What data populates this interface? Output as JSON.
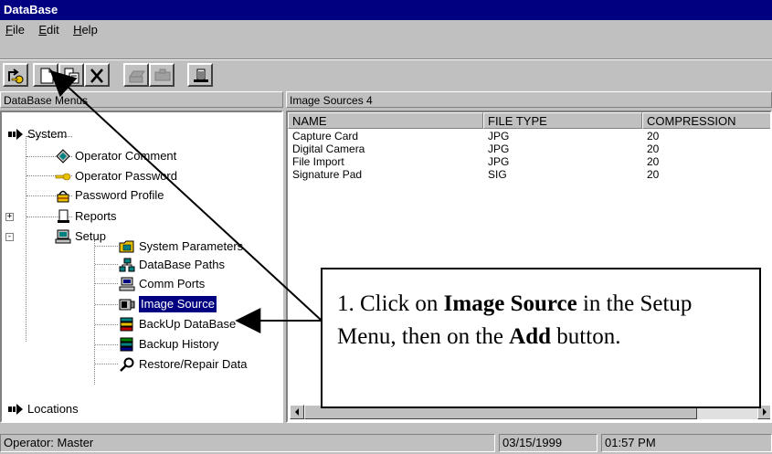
{
  "window": {
    "title": "DataBase"
  },
  "menu": {
    "file": "File",
    "file_key": "F",
    "file_rest": "ile",
    "edit": "Edit",
    "edit_key": "E",
    "edit_rest": "dit",
    "help": "Help",
    "help_key": "H",
    "help_rest": "elp"
  },
  "toolbar": {
    "buttons": [
      {
        "name": "exit-button",
        "icon": "key-exit-icon"
      },
      {
        "name": "add-button",
        "icon": "new-document-icon"
      },
      {
        "name": "copy-button",
        "icon": "copy-icon"
      },
      {
        "name": "delete-button",
        "icon": "delete-x-icon"
      },
      {
        "name": "print-button",
        "icon": "printer-icon"
      },
      {
        "name": "scan-button",
        "icon": "scanner-icon"
      },
      {
        "name": "report-button",
        "icon": "report-icon"
      }
    ]
  },
  "tree": {
    "header": "DataBase Menus",
    "items": [
      {
        "label": "System",
        "icon": "arrow-right-icon"
      },
      {
        "label": "Operator Comment",
        "icon": "comment-icon"
      },
      {
        "label": "Operator Password",
        "icon": "key-icon"
      },
      {
        "label": "Password Profile",
        "icon": "lock-profile-icon"
      },
      {
        "label": "Reports",
        "icon": "reports-icon"
      },
      {
        "label": "Setup",
        "icon": "computer-icon"
      },
      {
        "label": "System Parameters",
        "icon": "folder-settings-icon"
      },
      {
        "label": "DataBase Paths",
        "icon": "network-icon"
      },
      {
        "label": "Comm Ports",
        "icon": "port-icon"
      },
      {
        "label": "Image Source",
        "icon": "camera-icon"
      },
      {
        "label": "BackUp DataBase",
        "icon": "backup-icon"
      },
      {
        "label": "Backup History",
        "icon": "history-icon"
      },
      {
        "label": "Restore/Repair Data",
        "icon": "repair-icon"
      },
      {
        "label": "Locations",
        "icon": "arrow-right-icon"
      }
    ],
    "selected": "Image Source"
  },
  "list": {
    "header": "Image Sources  4",
    "columns": [
      "NAME",
      "FILE TYPE",
      "COMPRESSION"
    ],
    "rows": [
      [
        "Capture Card",
        "JPG",
        "20"
      ],
      [
        "Digital Camera",
        "JPG",
        "20"
      ],
      [
        "File Import",
        "JPG",
        "20"
      ],
      [
        "Signature Pad",
        "SIG",
        "20"
      ]
    ]
  },
  "status": {
    "operator": "Operator: Master",
    "date": "03/15/1999",
    "time": "01:57 PM"
  },
  "callout": {
    "p1": "1. Click on ",
    "b1": "Image Source",
    "p2": " in the Setup Menu, then on the ",
    "b2": "Add",
    "p3": " button."
  },
  "colors": {
    "titlebar": "#000080",
    "selection": "#000080",
    "face": "#c0c0c0"
  }
}
